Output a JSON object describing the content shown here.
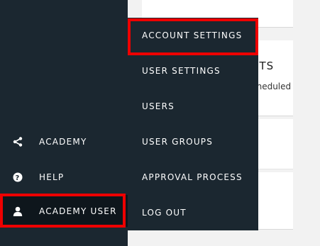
{
  "background": {
    "partial_heading": "STS",
    "partial_text": "cheduled"
  },
  "sidebar": {
    "items": [
      {
        "label": "ACADEMY",
        "icon": "share-icon"
      },
      {
        "label": "HELP",
        "icon": "help-circle-icon"
      },
      {
        "label": "ACADEMY USER",
        "icon": "user-icon"
      }
    ]
  },
  "user_menu": {
    "items": [
      {
        "label": "ACCOUNT SETTINGS"
      },
      {
        "label": "USER SETTINGS"
      },
      {
        "label": "USERS"
      },
      {
        "label": "USER GROUPS"
      },
      {
        "label": "APPROVAL PROCESS"
      },
      {
        "label": "LOG OUT"
      }
    ]
  },
  "colors": {
    "sidebar_bg": "#1b2730",
    "highlight": "#ee0000",
    "active_bg": "#0e161c"
  }
}
